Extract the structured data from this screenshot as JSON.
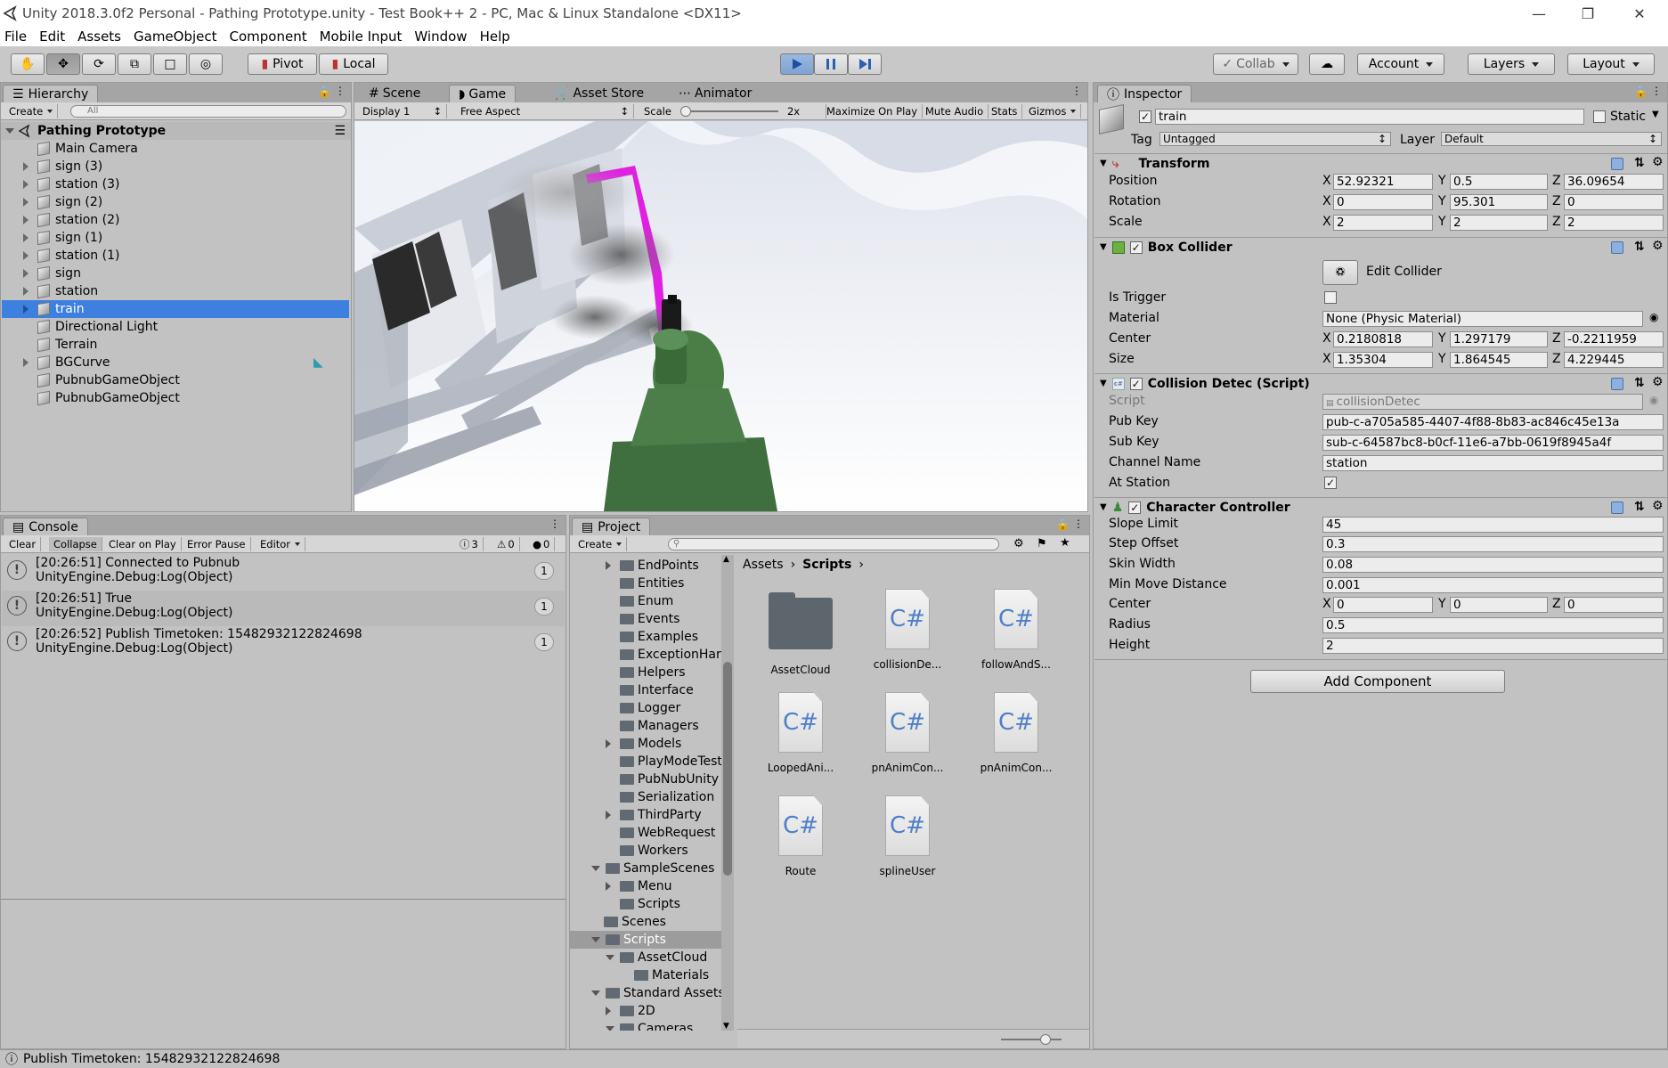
{
  "window": {
    "title": "Unity 2018.3.0f2 Personal - Pathing Prototype.unity - Test Book++ 2 - PC, Mac & Linux Standalone <DX11>"
  },
  "menu": [
    "File",
    "Edit",
    "Assets",
    "GameObject",
    "Component",
    "Mobile Input",
    "Window",
    "Help"
  ],
  "toolbar": {
    "pivot": "Pivot",
    "local": "Local",
    "collab": "Collab",
    "account": "Account",
    "layers": "Layers",
    "layout": "Layout"
  },
  "hierarchy": {
    "tab": "Hierarchy",
    "create": "Create",
    "search_placeholder": "All",
    "scene": "Pathing Prototype",
    "items": [
      {
        "label": "Main Camera"
      },
      {
        "label": "sign (3)"
      },
      {
        "label": "station (3)"
      },
      {
        "label": "sign (2)"
      },
      {
        "label": "station (2)"
      },
      {
        "label": "sign (1)"
      },
      {
        "label": "station (1)"
      },
      {
        "label": "sign"
      },
      {
        "label": "station"
      },
      {
        "label": "train"
      },
      {
        "label": "Directional Light"
      },
      {
        "label": "Terrain"
      },
      {
        "label": "BGCurve"
      },
      {
        "label": "PubnubGameObject"
      },
      {
        "label": "PubnubGameObject"
      }
    ]
  },
  "game": {
    "tabs": [
      "Scene",
      "Game",
      "Asset Store",
      "Animator"
    ],
    "display": "Display 1",
    "aspect": "Free Aspect",
    "scale_label": "Scale",
    "scale_value": "2x",
    "buttons": [
      "Maximize On Play",
      "Mute Audio",
      "Stats",
      "Gizmos"
    ]
  },
  "console": {
    "tab": "Console",
    "buttons": [
      "Clear",
      "Collapse",
      "Clear on Play",
      "Error Pause",
      "Editor"
    ],
    "counts": {
      "info": "3",
      "warn": "0",
      "error": "0"
    },
    "entries": [
      {
        "line1": "[20:26:51] Connected to Pubnub",
        "line2": "UnityEngine.Debug:Log(Object)",
        "count": "1"
      },
      {
        "line1": "[20:26:51] True",
        "line2": "UnityEngine.Debug:Log(Object)",
        "count": "1"
      },
      {
        "line1": "[20:26:52] Publish Timetoken: 15482932122824698",
        "line2": "UnityEngine.Debug:Log(Object)",
        "count": "1"
      }
    ]
  },
  "project": {
    "tab": "Project",
    "create": "Create",
    "breadcrumb": {
      "root": "Assets",
      "current": "Scripts"
    },
    "tree": [
      "EndPoints",
      "Entities",
      "Enum",
      "Events",
      "Examples",
      "ExceptionHar",
      "Helpers",
      "Interface",
      "Logger",
      "Managers",
      "Models",
      "PlayModeTest",
      "PubNubUnity",
      "Serialization",
      "ThirdParty",
      "WebRequest",
      "Workers",
      "SampleScenes",
      "Menu",
      "Scripts",
      "Scenes",
      "Scripts",
      "AssetCloud",
      "Materials",
      "Standard Assets",
      "2D",
      "Cameras"
    ],
    "assets": [
      {
        "label": "AssetCloud",
        "kind": "folder"
      },
      {
        "label": "collisionDe...",
        "kind": "cs"
      },
      {
        "label": "followAndS...",
        "kind": "cs"
      },
      {
        "label": "LoopedAni...",
        "kind": "cs"
      },
      {
        "label": "pnAnimCon...",
        "kind": "cs"
      },
      {
        "label": "pnAnimCon...",
        "kind": "cs"
      },
      {
        "label": "Route",
        "kind": "cs"
      },
      {
        "label": "splineUser",
        "kind": "cs"
      }
    ],
    "cs_glyph": "C#"
  },
  "inspector": {
    "tab": "Inspector",
    "object_name": "train",
    "static": "Static",
    "tag_label": "Tag",
    "tag": "Untagged",
    "layer_label": "Layer",
    "layer": "Default",
    "transform": {
      "title": "Transform",
      "position": {
        "label": "Position",
        "x": "52.92321",
        "y": "0.5",
        "z": "36.09654"
      },
      "rotation": {
        "label": "Rotation",
        "x": "0",
        "y": "95.301",
        "z": "0"
      },
      "scale": {
        "label": "Scale",
        "x": "2",
        "y": "2",
        "z": "2"
      }
    },
    "box_collider": {
      "title": "Box Collider",
      "edit": "Edit Collider",
      "is_trigger": "Is Trigger",
      "material_label": "Material",
      "material": "None (Physic Material)",
      "center": {
        "label": "Center",
        "x": "0.2180818",
        "y": "1.297179",
        "z": "-0.2211959"
      },
      "size": {
        "label": "Size",
        "x": "1.35304",
        "y": "1.864545",
        "z": "4.229445"
      }
    },
    "collision_script": {
      "title": "Collision Detec (Script)",
      "script_label": "Script",
      "script": "collisionDetec",
      "pub_label": "Pub Key",
      "pub": "pub-c-a705a585-4407-4f88-8b83-ac846c45e13a",
      "sub_label": "Sub Key",
      "sub": "sub-c-64587bc8-b0cf-11e6-a7bb-0619f8945a4f",
      "channel_label": "Channel Name",
      "channel": "station",
      "at_station": "At Station"
    },
    "character_controller": {
      "title": "Character Controller",
      "slope_label": "Slope Limit",
      "slope": "45",
      "step_label": "Step Offset",
      "step": "0.3",
      "skin_label": "Skin Width",
      "skin": "0.08",
      "minmove_label": "Min Move Distance",
      "minmove": "0.001",
      "center": {
        "label": "Center",
        "x": "0",
        "y": "0",
        "z": "0"
      },
      "radius_label": "Radius",
      "radius": "0.5",
      "height_label": "Height",
      "height": "2"
    },
    "add_component": "Add Component",
    "axes": [
      "X",
      "Y",
      "Z"
    ]
  },
  "status": {
    "text": "Publish Timetoken: 15482932122824698"
  },
  "colors": {
    "selection": "#3d80df",
    "pink_path": "#e020e0",
    "train_green": "#3d7a3d"
  }
}
